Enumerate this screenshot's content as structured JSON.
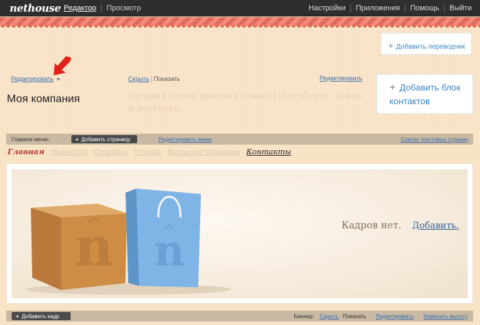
{
  "topbar": {
    "logo": "nethouse",
    "nav": [
      "Редактор",
      "Просмотр"
    ],
    "right": [
      "Настройки",
      "Приложения",
      "Помощь",
      "Выйти"
    ]
  },
  "header": {
    "add_translator": "Добавить переводчик",
    "edit_left": "Редактировать",
    "hide": "Скрыть",
    "show": "Показать",
    "edit_mid": "Редактировать",
    "company_name": "Моя компания",
    "slogan": "Лучший салон цветов в Санкт-Петербурге.  Заказ и доставка.",
    "add_contacts": "Добавить блок контактов"
  },
  "menubar": {
    "label": "Главное меню:",
    "add_page": "Добавить страницу",
    "edit_menu": "Редактировать меню",
    "text_pages": "Список текстовых страниц"
  },
  "nav": {
    "items": [
      {
        "label": "Главная",
        "state": "current"
      },
      {
        "label": "Новости",
        "state": "hidden"
      },
      {
        "label": "Статьи",
        "state": "hidden"
      },
      {
        "label": "Услуги",
        "state": "hidden"
      },
      {
        "label": "Каталог товаров",
        "state": "hidden"
      },
      {
        "label": "Контакты",
        "state": "visible"
      }
    ]
  },
  "banner": {
    "no_frames": "Кадров нет.",
    "add": "Добавить."
  },
  "bottombar": {
    "add_frame": "Добавить кадр",
    "banner_label": "Баннер:",
    "hide": "Скрыть",
    "show": "Показать",
    "edit": "Редактировать",
    "change_height": "Изменить высоту"
  },
  "icons": {
    "pointer_arrow": "red-arrow-icon"
  },
  "colors": {
    "topbar": "#2e2e2e",
    "stripe": "#e26a5b",
    "link": "#3a6fb0",
    "active_nav": "#b23a2c"
  }
}
